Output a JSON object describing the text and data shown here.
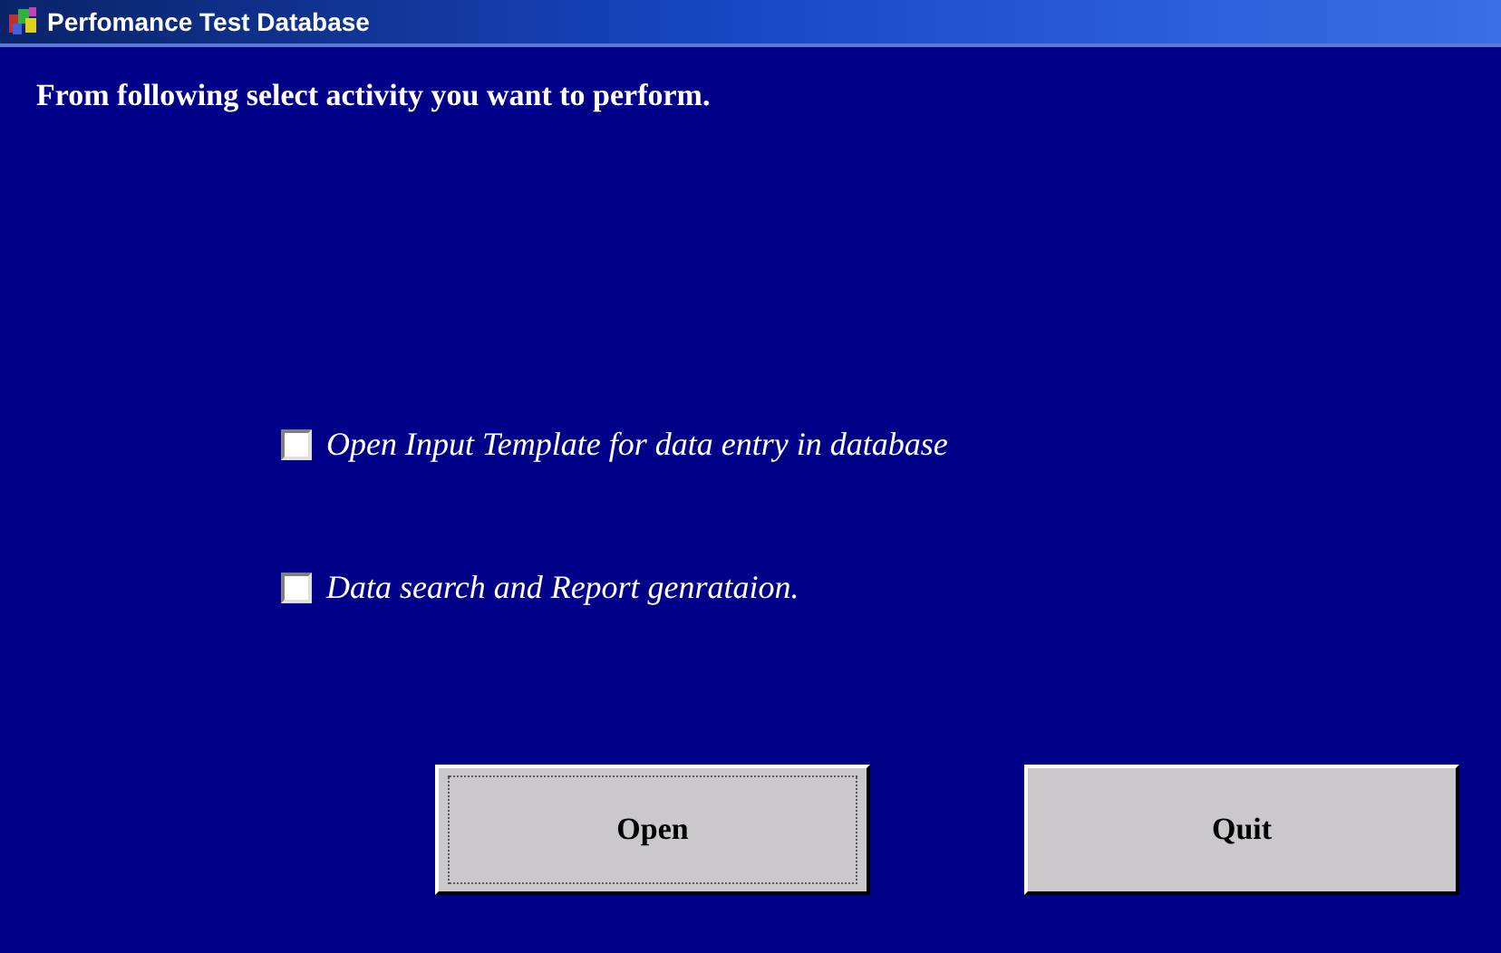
{
  "window": {
    "title": "Perfomance Test Database"
  },
  "prompt": "From following select activity you want to perform.",
  "options": [
    {
      "label": "Open Input Template for data entry in database",
      "checked": false
    },
    {
      "label": "Data search and Report genrataion.",
      "checked": false
    }
  ],
  "buttons": [
    {
      "label": "Open",
      "focused": true
    },
    {
      "label": "Quit",
      "focused": false
    }
  ]
}
